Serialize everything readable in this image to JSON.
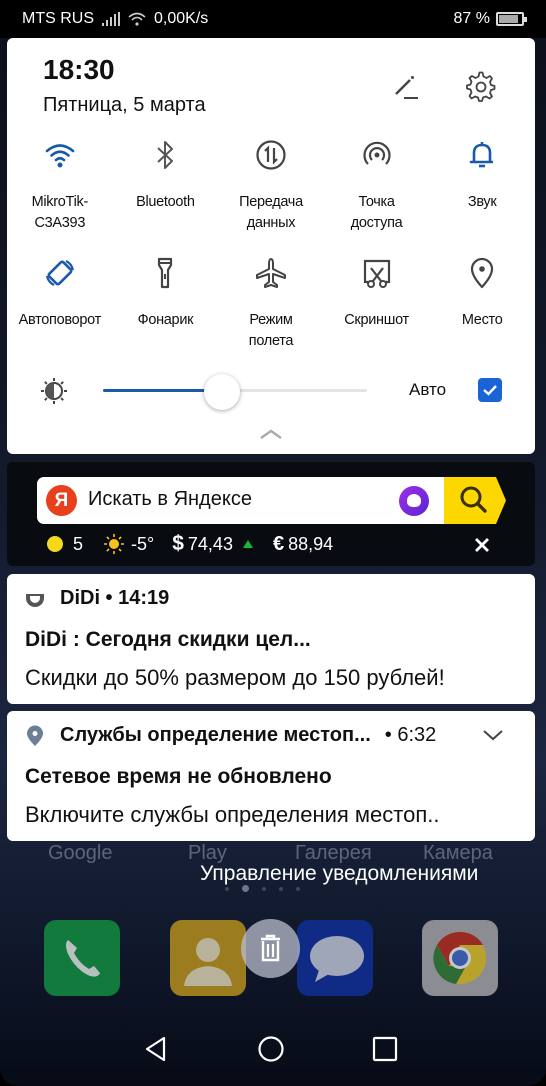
{
  "statusbar": {
    "carrier": "MTS RUS",
    "net_speed": "0,00K/s",
    "battery_percent": "87 %",
    "battery_level": 0.87
  },
  "quick_settings": {
    "time": "18:30",
    "date": "Пятница, 5 марта",
    "edit_icon": "pencil-icon",
    "settings_icon": "gear-icon",
    "tiles": [
      {
        "label_line1": "MikroTik-",
        "label_line2": "C3A393",
        "icon": "wifi-icon",
        "active": true
      },
      {
        "label_line1": "Bluetooth",
        "label_line2": "",
        "icon": "bluetooth-icon",
        "active": false
      },
      {
        "label_line1": "Передача",
        "label_line2": "данных",
        "icon": "mobile-data-icon",
        "active": false
      },
      {
        "label_line1": "Точка",
        "label_line2": "доступа",
        "icon": "hotspot-icon",
        "active": false
      },
      {
        "label_line1": "Звук",
        "label_line2": "",
        "icon": "bell-icon",
        "active": true
      },
      {
        "label_line1": "Автоповорот",
        "label_line2": "",
        "icon": "auto-rotate-icon",
        "active": true
      },
      {
        "label_line1": "Фонарик",
        "label_line2": "",
        "icon": "flashlight-icon",
        "active": false
      },
      {
        "label_line1": "Режим",
        "label_line2": "полета",
        "icon": "airplane-icon",
        "active": false
      },
      {
        "label_line1": "Скриншот",
        "label_line2": "",
        "icon": "screenshot-icon",
        "active": false
      },
      {
        "label_line1": "Место",
        "label_line2": "",
        "icon": "location-icon",
        "active": false
      }
    ],
    "brightness": {
      "level": 0.45,
      "auto_label": "Авто",
      "auto_checked": true
    },
    "accent_color": "#1a5aa8"
  },
  "yandex_widget": {
    "logo_letter": "Я",
    "search_placeholder": "Искать в Яндексе",
    "traffic_score": "5",
    "temperature": "-5°",
    "usd_symbol": "$",
    "usd_rate": "74,43",
    "eur_symbol": "€",
    "eur_rate": "88,94"
  },
  "notifications": [
    {
      "app": "DiDi",
      "time": "14:19",
      "title": "DiDi :  Сегодня скидки цел...",
      "body": "Скидки до 50% размером до 150 рублей!"
    },
    {
      "app": "Службы определение местоп...",
      "time": "• 6:32",
      "title": "Сетевое время не обновлено",
      "body": "Включите службы определения местоп.."
    }
  ],
  "home_screen": {
    "labels": [
      "Google",
      "Play",
      "Галерея",
      "Камера"
    ],
    "manage_notifications": "Управление уведомлениями",
    "dock": [
      "phone",
      "contacts",
      "messages",
      "chrome"
    ]
  },
  "navbar": [
    "back",
    "home",
    "recents"
  ]
}
